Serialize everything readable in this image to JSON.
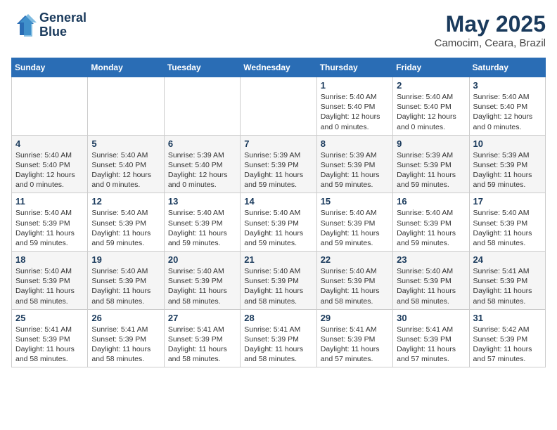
{
  "header": {
    "logo_line1": "General",
    "logo_line2": "Blue",
    "month": "May 2025",
    "location": "Camocim, Ceara, Brazil"
  },
  "weekdays": [
    "Sunday",
    "Monday",
    "Tuesday",
    "Wednesday",
    "Thursday",
    "Friday",
    "Saturday"
  ],
  "weeks": [
    [
      {
        "day": "",
        "info": ""
      },
      {
        "day": "",
        "info": ""
      },
      {
        "day": "",
        "info": ""
      },
      {
        "day": "",
        "info": ""
      },
      {
        "day": "1",
        "info": "Sunrise: 5:40 AM\nSunset: 5:40 PM\nDaylight: 12 hours and 0 minutes."
      },
      {
        "day": "2",
        "info": "Sunrise: 5:40 AM\nSunset: 5:40 PM\nDaylight: 12 hours and 0 minutes."
      },
      {
        "day": "3",
        "info": "Sunrise: 5:40 AM\nSunset: 5:40 PM\nDaylight: 12 hours and 0 minutes."
      }
    ],
    [
      {
        "day": "4",
        "info": "Sunrise: 5:40 AM\nSunset: 5:40 PM\nDaylight: 12 hours and 0 minutes."
      },
      {
        "day": "5",
        "info": "Sunrise: 5:40 AM\nSunset: 5:40 PM\nDaylight: 12 hours and 0 minutes."
      },
      {
        "day": "6",
        "info": "Sunrise: 5:39 AM\nSunset: 5:40 PM\nDaylight: 12 hours and 0 minutes."
      },
      {
        "day": "7",
        "info": "Sunrise: 5:39 AM\nSunset: 5:39 PM\nDaylight: 11 hours and 59 minutes."
      },
      {
        "day": "8",
        "info": "Sunrise: 5:39 AM\nSunset: 5:39 PM\nDaylight: 11 hours and 59 minutes."
      },
      {
        "day": "9",
        "info": "Sunrise: 5:39 AM\nSunset: 5:39 PM\nDaylight: 11 hours and 59 minutes."
      },
      {
        "day": "10",
        "info": "Sunrise: 5:39 AM\nSunset: 5:39 PM\nDaylight: 11 hours and 59 minutes."
      }
    ],
    [
      {
        "day": "11",
        "info": "Sunrise: 5:40 AM\nSunset: 5:39 PM\nDaylight: 11 hours and 59 minutes."
      },
      {
        "day": "12",
        "info": "Sunrise: 5:40 AM\nSunset: 5:39 PM\nDaylight: 11 hours and 59 minutes."
      },
      {
        "day": "13",
        "info": "Sunrise: 5:40 AM\nSunset: 5:39 PM\nDaylight: 11 hours and 59 minutes."
      },
      {
        "day": "14",
        "info": "Sunrise: 5:40 AM\nSunset: 5:39 PM\nDaylight: 11 hours and 59 minutes."
      },
      {
        "day": "15",
        "info": "Sunrise: 5:40 AM\nSunset: 5:39 PM\nDaylight: 11 hours and 59 minutes."
      },
      {
        "day": "16",
        "info": "Sunrise: 5:40 AM\nSunset: 5:39 PM\nDaylight: 11 hours and 59 minutes."
      },
      {
        "day": "17",
        "info": "Sunrise: 5:40 AM\nSunset: 5:39 PM\nDaylight: 11 hours and 58 minutes."
      }
    ],
    [
      {
        "day": "18",
        "info": "Sunrise: 5:40 AM\nSunset: 5:39 PM\nDaylight: 11 hours and 58 minutes."
      },
      {
        "day": "19",
        "info": "Sunrise: 5:40 AM\nSunset: 5:39 PM\nDaylight: 11 hours and 58 minutes."
      },
      {
        "day": "20",
        "info": "Sunrise: 5:40 AM\nSunset: 5:39 PM\nDaylight: 11 hours and 58 minutes."
      },
      {
        "day": "21",
        "info": "Sunrise: 5:40 AM\nSunset: 5:39 PM\nDaylight: 11 hours and 58 minutes."
      },
      {
        "day": "22",
        "info": "Sunrise: 5:40 AM\nSunset: 5:39 PM\nDaylight: 11 hours and 58 minutes."
      },
      {
        "day": "23",
        "info": "Sunrise: 5:40 AM\nSunset: 5:39 PM\nDaylight: 11 hours and 58 minutes."
      },
      {
        "day": "24",
        "info": "Sunrise: 5:41 AM\nSunset: 5:39 PM\nDaylight: 11 hours and 58 minutes."
      }
    ],
    [
      {
        "day": "25",
        "info": "Sunrise: 5:41 AM\nSunset: 5:39 PM\nDaylight: 11 hours and 58 minutes."
      },
      {
        "day": "26",
        "info": "Sunrise: 5:41 AM\nSunset: 5:39 PM\nDaylight: 11 hours and 58 minutes."
      },
      {
        "day": "27",
        "info": "Sunrise: 5:41 AM\nSunset: 5:39 PM\nDaylight: 11 hours and 58 minutes."
      },
      {
        "day": "28",
        "info": "Sunrise: 5:41 AM\nSunset: 5:39 PM\nDaylight: 11 hours and 58 minutes."
      },
      {
        "day": "29",
        "info": "Sunrise: 5:41 AM\nSunset: 5:39 PM\nDaylight: 11 hours and 57 minutes."
      },
      {
        "day": "30",
        "info": "Sunrise: 5:41 AM\nSunset: 5:39 PM\nDaylight: 11 hours and 57 minutes."
      },
      {
        "day": "31",
        "info": "Sunrise: 5:42 AM\nSunset: 5:39 PM\nDaylight: 11 hours and 57 minutes."
      }
    ]
  ]
}
